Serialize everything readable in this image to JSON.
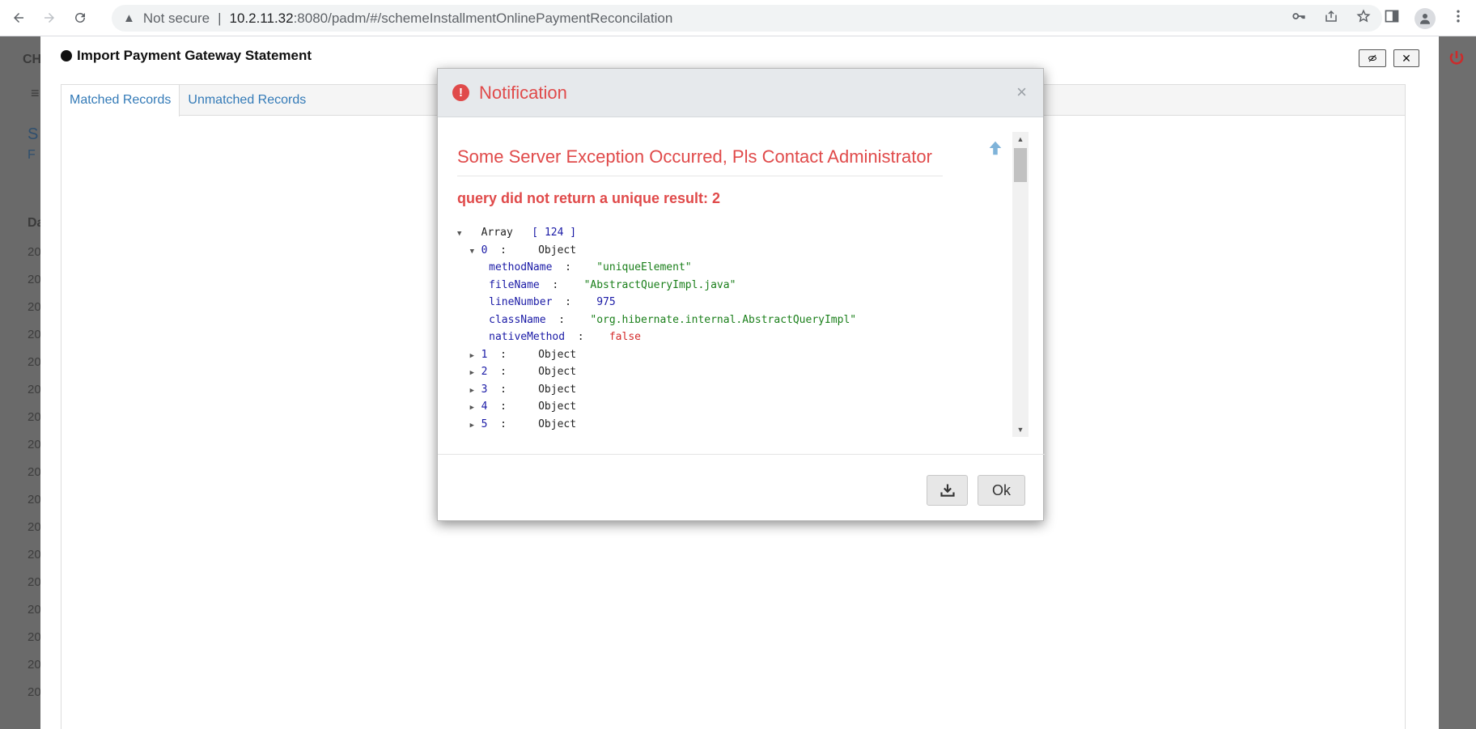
{
  "browser": {
    "security_label": "Not secure",
    "url_host": "10.2.11.32",
    "url_path": ":8080/padm/#/schemeInstallmentOnlinePaymentReconcilation"
  },
  "background": {
    "header_fragment": "CH",
    "panel_fragment_1": "S",
    "panel_fragment_2": "F",
    "col_fragment": "Da",
    "row_prefix": "20"
  },
  "import_modal": {
    "title": "Import Payment Gateway Statement",
    "tabs": [
      {
        "label": "Matched Records",
        "active": true
      },
      {
        "label": "Unmatched Records",
        "active": false
      }
    ]
  },
  "notification": {
    "title": "Notification",
    "close_glyph": "×",
    "error_title": "Some Server Exception Occurred, Pls Contact Administrator",
    "error_message": "query did not return a unique result: 2",
    "tree": {
      "root_label": "Array",
      "root_count": "124",
      "item0": {
        "index": "0",
        "type": "Object",
        "fields": [
          {
            "key": "methodName",
            "value": "\"uniqueElement\"",
            "kind": "str"
          },
          {
            "key": "fileName",
            "value": "\"AbstractQueryImpl.java\"",
            "kind": "str"
          },
          {
            "key": "lineNumber",
            "value": "975",
            "kind": "num"
          },
          {
            "key": "className",
            "value": "\"org.hibernate.internal.AbstractQueryImpl\"",
            "kind": "str"
          },
          {
            "key": "nativeMethod",
            "value": "false",
            "kind": "bool"
          }
        ]
      },
      "collapsed": [
        {
          "index": "1",
          "type": "Object"
        },
        {
          "index": "2",
          "type": "Object"
        },
        {
          "index": "3",
          "type": "Object"
        },
        {
          "index": "4",
          "type": "Object"
        },
        {
          "index": "5",
          "type": "Object"
        }
      ]
    },
    "ok_label": "Ok"
  },
  "colors": {
    "error_red": "#e04a4a",
    "link_blue": "#337ab7"
  }
}
